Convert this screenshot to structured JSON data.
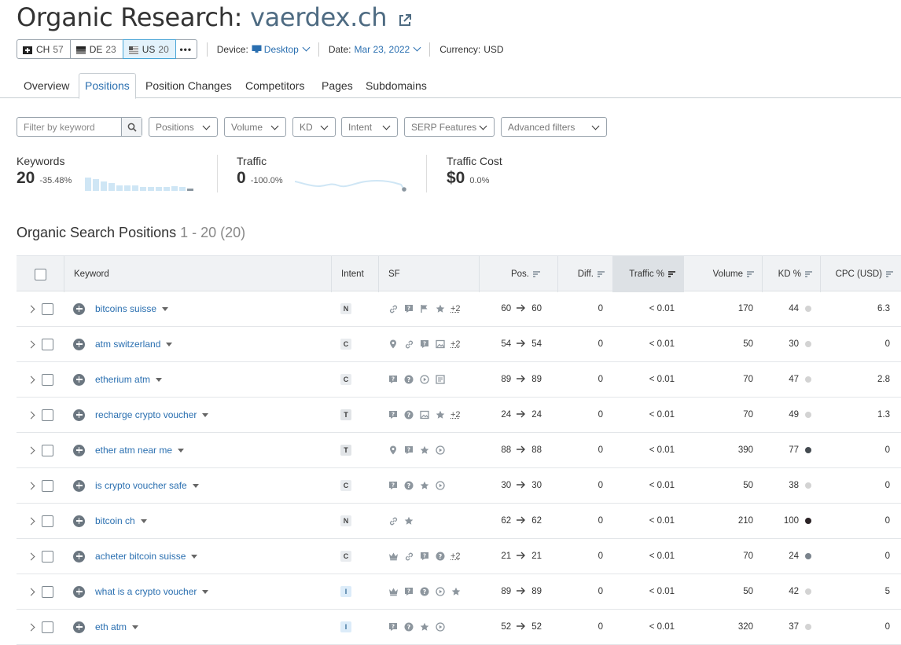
{
  "header": {
    "title_prefix": "Organic Research:",
    "domain": "vaerdex.ch",
    "external_link_icon": "external-link-icon"
  },
  "databases": [
    {
      "code": "CH",
      "count": "57",
      "flag": "ch-flag"
    },
    {
      "code": "DE",
      "count": "23",
      "flag": "de-flag"
    },
    {
      "code": "US",
      "count": "20",
      "flag": "us-flag",
      "active": true
    }
  ],
  "more_label": "•••",
  "controls": {
    "device_label": "Device:",
    "device_value": "Desktop",
    "date_label": "Date:",
    "date_value": "Mar 23, 2022",
    "currency_label": "Currency:",
    "currency_value": "USD"
  },
  "tabs": [
    "Overview",
    "Positions",
    "Position Changes",
    "Competitors",
    "Pages",
    "Subdomains"
  ],
  "active_tab": "Positions",
  "filters": {
    "search_placeholder": "Filter by keyword",
    "positions": "Positions",
    "volume": "Volume",
    "kd": "KD",
    "intent": "Intent",
    "serp": "SERP Features",
    "advanced": "Advanced filters"
  },
  "stats": {
    "keywords": {
      "label": "Keywords",
      "value": "20",
      "change": "-35.48%"
    },
    "traffic": {
      "label": "Traffic",
      "value": "0",
      "change": "-100.0%"
    },
    "traffic_cost": {
      "label": "Traffic Cost",
      "value": "$0",
      "change": "0.0%"
    }
  },
  "section": {
    "title": "Organic Search Positions",
    "count": "1 - 20 (20)"
  },
  "table": {
    "headers": {
      "keyword": "Keyword",
      "intent": "Intent",
      "sf": "SF",
      "pos": "Pos.",
      "diff": "Diff.",
      "traffic": "Traffic %",
      "volume": "Volume",
      "kd": "KD %",
      "cpc": "CPC (USD)"
    },
    "rows": [
      {
        "keyword": "bitcoins suisse",
        "intent": "N",
        "sf": [
          "link-icon",
          "faq-icon",
          "flag-icon",
          "star-icon"
        ],
        "sf_more": "+2",
        "pos_from": "60",
        "pos_to": "60",
        "diff": "0",
        "traffic": "< 0.01",
        "volume": "170",
        "kd": "44",
        "kd_color": "#d3d3d3",
        "cpc": "6.3"
      },
      {
        "keyword": "atm switzerland",
        "intent": "C",
        "sf": [
          "pin-icon",
          "link-icon",
          "faq-icon",
          "image-icon"
        ],
        "sf_more": "+2",
        "pos_from": "54",
        "pos_to": "54",
        "diff": "0",
        "traffic": "< 0.01",
        "volume": "50",
        "kd": "30",
        "kd_color": "#d3d3d3",
        "cpc": "0"
      },
      {
        "keyword": "etherium atm",
        "intent": "C",
        "sf": [
          "faq-icon",
          "question-icon",
          "video-icon",
          "news-icon"
        ],
        "sf_more": "",
        "pos_from": "89",
        "pos_to": "89",
        "diff": "0",
        "traffic": "< 0.01",
        "volume": "70",
        "kd": "47",
        "kd_color": "#d3d3d3",
        "cpc": "2.8"
      },
      {
        "keyword": "recharge crypto voucher",
        "intent": "T",
        "sf": [
          "faq-icon",
          "question-icon",
          "image-icon",
          "star-icon"
        ],
        "sf_more": "+2",
        "pos_from": "24",
        "pos_to": "24",
        "diff": "0",
        "traffic": "< 0.01",
        "volume": "70",
        "kd": "49",
        "kd_color": "#d3d3d3",
        "cpc": "1.3"
      },
      {
        "keyword": "ether atm near me",
        "intent": "T",
        "sf": [
          "pin-icon",
          "faq-icon",
          "star-icon",
          "video-icon"
        ],
        "sf_more": "",
        "pos_from": "88",
        "pos_to": "88",
        "diff": "0",
        "traffic": "< 0.01",
        "volume": "390",
        "kd": "77",
        "kd_color": "#444a50",
        "cpc": "0"
      },
      {
        "keyword": "is crypto voucher safe",
        "intent": "C",
        "sf": [
          "faq-icon",
          "question-icon",
          "star-icon",
          "video-icon"
        ],
        "sf_more": "",
        "pos_from": "30",
        "pos_to": "30",
        "diff": "0",
        "traffic": "< 0.01",
        "volume": "50",
        "kd": "38",
        "kd_color": "#d3d3d3",
        "cpc": "0"
      },
      {
        "keyword": "bitcoin ch",
        "intent": "N",
        "sf": [
          "link-icon",
          "star-icon"
        ],
        "sf_more": "",
        "pos_from": "62",
        "pos_to": "62",
        "diff": "0",
        "traffic": "< 0.01",
        "volume": "210",
        "kd": "100",
        "kd_color": "#2b2326",
        "cpc": "0"
      },
      {
        "keyword": "acheter bitcoin suisse",
        "intent": "C",
        "sf": [
          "crown-icon",
          "link-icon",
          "faq-icon",
          "question-icon"
        ],
        "sf_more": "+2",
        "pos_from": "21",
        "pos_to": "21",
        "diff": "0",
        "traffic": "< 0.01",
        "volume": "70",
        "kd": "24",
        "kd_color": "#7a838c",
        "cpc": "0"
      },
      {
        "keyword": "what is a crypto voucher",
        "intent": "I",
        "sf": [
          "crown-icon",
          "faq-icon",
          "question-icon",
          "video-icon",
          "star-icon"
        ],
        "sf_more": "",
        "pos_from": "89",
        "pos_to": "89",
        "diff": "0",
        "traffic": "< 0.01",
        "volume": "50",
        "kd": "42",
        "kd_color": "#d3d3d3",
        "cpc": "5"
      },
      {
        "keyword": "eth atm",
        "intent": "I",
        "sf": [
          "faq-icon",
          "question-icon",
          "star-icon",
          "video-icon"
        ],
        "sf_more": "",
        "pos_from": "52",
        "pos_to": "52",
        "diff": "0",
        "traffic": "< 0.01",
        "volume": "320",
        "kd": "37",
        "kd_color": "#d3d3d3",
        "cpc": "0"
      }
    ]
  }
}
